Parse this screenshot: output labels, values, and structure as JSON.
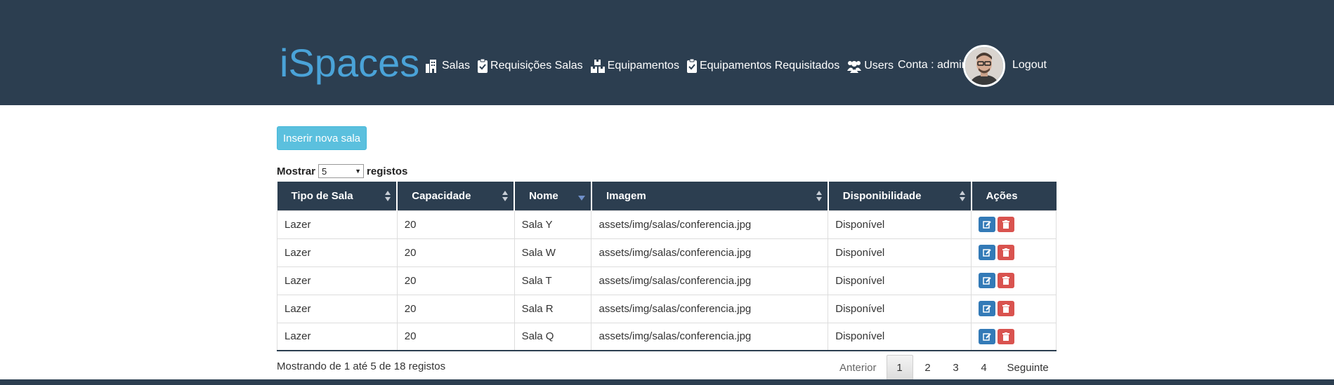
{
  "header": {
    "brand": "iSpaces",
    "nav": [
      {
        "label": "Salas",
        "icon": "building-icon"
      },
      {
        "label": "Requisições Salas",
        "icon": "clipboard-check-icon"
      },
      {
        "label": "Equipamentos",
        "icon": "boxes-icon"
      },
      {
        "label": "Equipamentos Requisitados",
        "icon": "clipboard-check-icon"
      },
      {
        "label": "Users",
        "icon": "users-icon"
      }
    ],
    "account_label": "Conta : admin",
    "logout_label": "Logout",
    "colors": {
      "bar": "#2c3e50",
      "brand": "#4aa3d8"
    }
  },
  "actions": {
    "insert_label": "Inserir nova sala"
  },
  "length": {
    "prefix": "Mostrar",
    "value": "5",
    "suffix": "registos"
  },
  "table": {
    "columns": [
      "Tipo de Sala",
      "Capacidade",
      "Nome",
      "Imagem",
      "Disponibilidade",
      "Ações"
    ],
    "sorted_column": "Nome",
    "rows": [
      {
        "tipo": "Lazer",
        "capacidade": "20",
        "nome": "Sala Y",
        "imagem": "assets/img/salas/conferencia.jpg",
        "disponibilidade": "Disponível"
      },
      {
        "tipo": "Lazer",
        "capacidade": "20",
        "nome": "Sala W",
        "imagem": "assets/img/salas/conferencia.jpg",
        "disponibilidade": "Disponível"
      },
      {
        "tipo": "Lazer",
        "capacidade": "20",
        "nome": "Sala T",
        "imagem": "assets/img/salas/conferencia.jpg",
        "disponibilidade": "Disponível"
      },
      {
        "tipo": "Lazer",
        "capacidade": "20",
        "nome": "Sala R",
        "imagem": "assets/img/salas/conferencia.jpg",
        "disponibilidade": "Disponível"
      },
      {
        "tipo": "Lazer",
        "capacidade": "20",
        "nome": "Sala Q",
        "imagem": "assets/img/salas/conferencia.jpg",
        "disponibilidade": "Disponível"
      }
    ]
  },
  "footer": {
    "info": "Mostrando de 1 até 5 de 18 registos",
    "pagination": {
      "previous": "Anterior",
      "pages": [
        "1",
        "2",
        "3",
        "4"
      ],
      "current": "1",
      "next": "Seguinte"
    }
  }
}
